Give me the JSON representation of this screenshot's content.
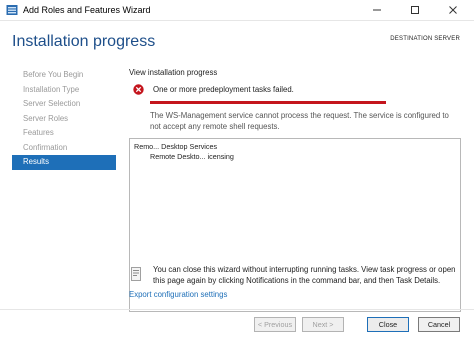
{
  "window": {
    "title": "Add Roles and Features Wizard"
  },
  "header": {
    "page_title": "Installation progress",
    "destination_label": "DESTINATION SERVER"
  },
  "nav": {
    "items": [
      {
        "label": "Before You Begin",
        "active": false
      },
      {
        "label": "Installation Type",
        "active": false
      },
      {
        "label": "Server Selection",
        "active": false
      },
      {
        "label": "Server Roles",
        "active": false
      },
      {
        "label": "Features",
        "active": false
      },
      {
        "label": "Confirmation",
        "active": false
      },
      {
        "label": "Results",
        "active": true
      }
    ]
  },
  "main": {
    "section_label": "View installation progress",
    "error_text": "One or more predeployment tasks failed.",
    "progress": 1.0,
    "service_message": "The WS-Management service cannot process the request. The service is configured to not accept any remote shell requests.",
    "results": {
      "line1": "Remo... Desktop Services",
      "line2": "Remote Deskto... icensing"
    },
    "note": "You can close this wizard without interrupting running tasks. View task progress or open this page again by clicking Notifications in the command bar, and then Task Details.",
    "export_link": "Export configuration settings"
  },
  "buttons": {
    "previous": "< Previous",
    "next": "Next >",
    "close": "Close",
    "cancel": "Cancel"
  },
  "colors": {
    "title_blue": "#1e4f8a",
    "nav_active": "#1e6fb8",
    "error_red": "#c4151d",
    "link_blue": "#1e6fb8"
  },
  "icons": {
    "app": "server-manager-icon",
    "error": "error-icon",
    "note": "info-note-icon",
    "minimize": "minimize-icon",
    "maximize": "maximize-icon",
    "close": "close-icon"
  }
}
